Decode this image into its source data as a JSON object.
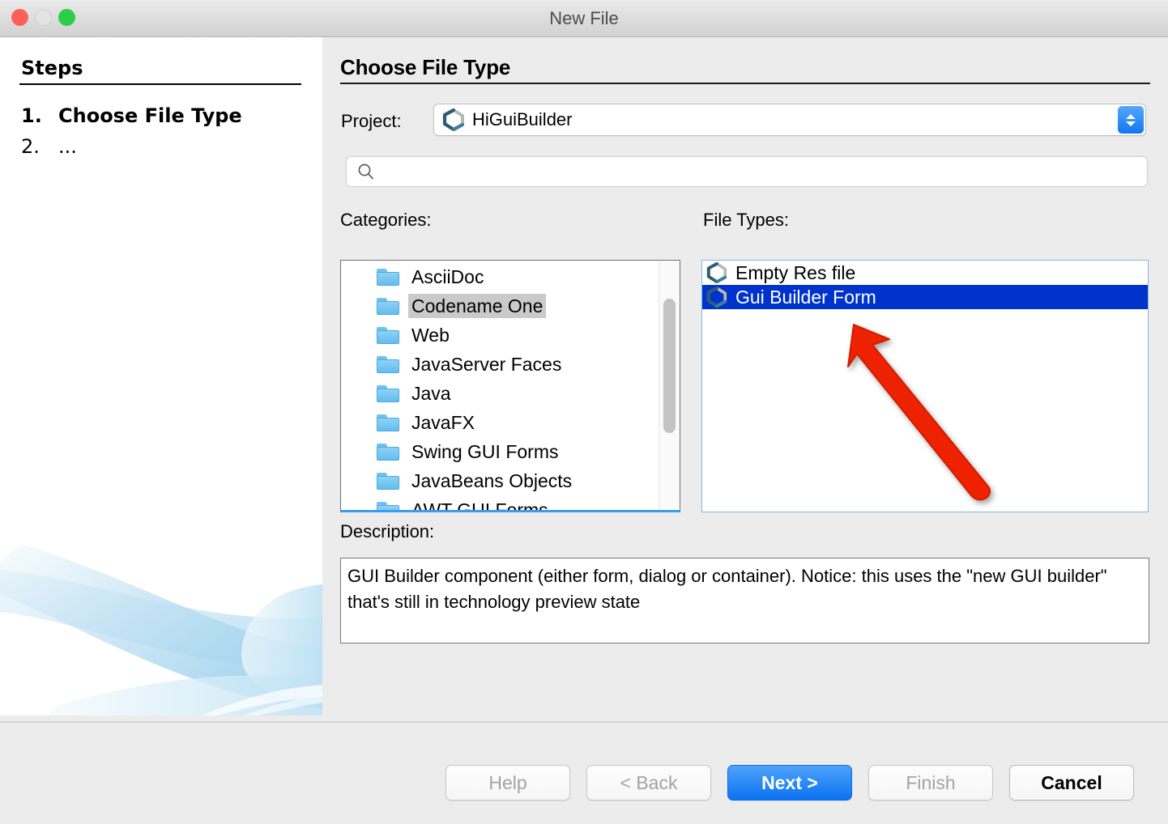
{
  "window": {
    "title": "New File",
    "traffic_lights": [
      {
        "name": "close-button",
        "color": "#ff6159"
      },
      {
        "name": "minimize-button",
        "color": "#e3e3e3"
      },
      {
        "name": "zoom-button",
        "color": "#2bce46"
      }
    ]
  },
  "steps_panel": {
    "heading": "Steps",
    "items": [
      {
        "number": "1.",
        "label": "Choose File Type",
        "current": true
      },
      {
        "number": "2.",
        "label": "...",
        "current": false
      }
    ]
  },
  "content": {
    "pane_title": "Choose File Type",
    "project": {
      "label": "Project:",
      "icon": "codename-one-logo-icon",
      "value": "HiGuiBuilder"
    },
    "search": {
      "icon": "search-icon",
      "value": "",
      "placeholder": ""
    },
    "categories": {
      "label": "Categories:",
      "items": [
        {
          "label": "AsciiDoc",
          "selected": false
        },
        {
          "label": "Codename One",
          "selected": true
        },
        {
          "label": "Web",
          "selected": false
        },
        {
          "label": "JavaServer Faces",
          "selected": false
        },
        {
          "label": "Java",
          "selected": false
        },
        {
          "label": "JavaFX",
          "selected": false
        },
        {
          "label": "Swing GUI Forms",
          "selected": false
        },
        {
          "label": "JavaBeans Objects",
          "selected": false
        },
        {
          "label": "AWT GUI Forms",
          "selected": false
        }
      ]
    },
    "file_types": {
      "label": "File Types:",
      "items": [
        {
          "label": "Empty Res file",
          "selected": false
        },
        {
          "label": "Gui Builder Form",
          "selected": true
        }
      ]
    },
    "annotation": {
      "name": "red-arrow-annotation",
      "color": "#ee2200",
      "points_at": "Gui Builder Form"
    },
    "description": {
      "label": "Description:",
      "text": "GUI Builder component (either form, dialog or container). Notice: this uses the \"new GUI builder\" that's still in technology preview state"
    }
  },
  "footer": {
    "buttons": [
      {
        "name": "help-button",
        "label": "Help",
        "state": "disabled"
      },
      {
        "name": "back-button",
        "label": "< Back",
        "state": "disabled"
      },
      {
        "name": "next-button",
        "label": "Next >",
        "state": "default"
      },
      {
        "name": "finish-button",
        "label": "Finish",
        "state": "disabled"
      },
      {
        "name": "cancel-button",
        "label": "Cancel",
        "state": "normal"
      }
    ]
  },
  "colors": {
    "dialog_bg": "#ececec",
    "panel_bg": "#ffffff",
    "selection_blue": "#0033cc",
    "accent_blue": "#0a72f0",
    "annotation_red": "#ee2200",
    "category_selection_gray": "#cacaca"
  }
}
